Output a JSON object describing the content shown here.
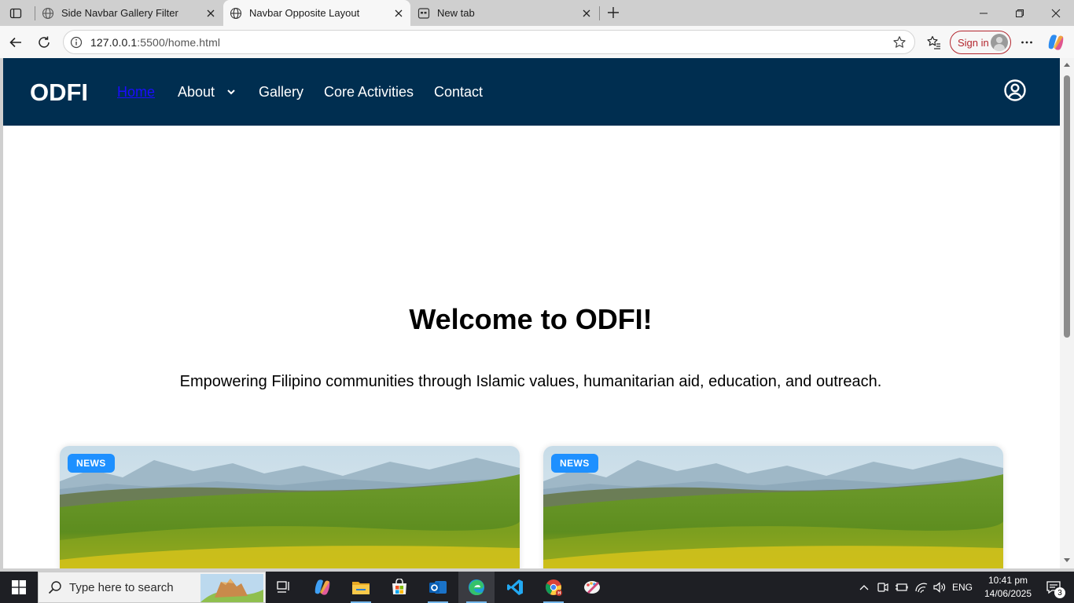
{
  "browser": {
    "tabs": [
      {
        "title": "Side Navbar Gallery Filter",
        "active": false
      },
      {
        "title": "Navbar Opposite Layout",
        "active": true
      },
      {
        "title": "New tab",
        "active": false
      }
    ],
    "address": {
      "host": "127.0.0.1",
      "rest": ":5500/home.html"
    },
    "sign_in_label": "Sign in"
  },
  "site": {
    "brand": "ODFI",
    "nav": {
      "home": "Home",
      "about": "About",
      "gallery": "Gallery",
      "core_activities": "Core Activities",
      "contact": "Contact"
    },
    "hero": {
      "title": "Welcome to ODFI!",
      "subtitle": "Empowering Filipino communities through Islamic values, humanitarian aid, education, and outreach."
    },
    "cards": [
      {
        "badge": "NEWS"
      },
      {
        "badge": "NEWS"
      }
    ],
    "colors": {
      "navbar": "#002e50",
      "badge": "#1e90ff",
      "home_link": "#1a0dff"
    }
  },
  "taskbar": {
    "search_placeholder": "Type here to search",
    "apps": [
      "task-view",
      "copilot",
      "file-explorer",
      "microsoft-store",
      "outlook",
      "edge",
      "vscode",
      "chrome",
      "paint"
    ],
    "language": "ENG",
    "time": "10:41 pm",
    "date": "14/06/2025",
    "notification_count": "3"
  }
}
